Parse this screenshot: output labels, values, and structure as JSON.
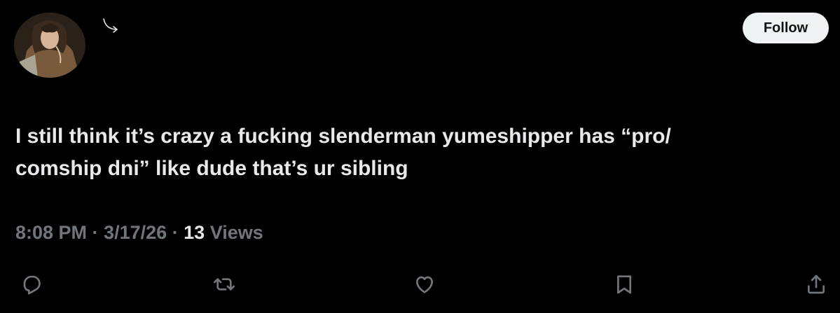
{
  "author": {
    "avatar_icon": "profile-photo",
    "arrow_icon": "curved-arrow-icon"
  },
  "follow_button": {
    "label": "Follow"
  },
  "tweet": {
    "text": "I still think it’s crazy a fucking slenderman yumeshipper has “pro/\ncomship dni” like dude that’s ur sibling"
  },
  "meta": {
    "time": "8:08 PM",
    "separator1": " · ",
    "date": "3/17/26",
    "separator2": " · ",
    "views_count": "13",
    "views_label": " Views"
  },
  "actions": [
    {
      "icon": "reply-icon"
    },
    {
      "icon": "retweet-icon"
    },
    {
      "icon": "like-icon"
    },
    {
      "icon": "bookmark-icon"
    },
    {
      "icon": "share-icon"
    }
  ],
  "colors": {
    "background": "#000000",
    "text_primary": "#e7e9ea",
    "text_secondary": "#71767b",
    "button_bg": "#eff3f4",
    "button_text": "#0f1419"
  }
}
